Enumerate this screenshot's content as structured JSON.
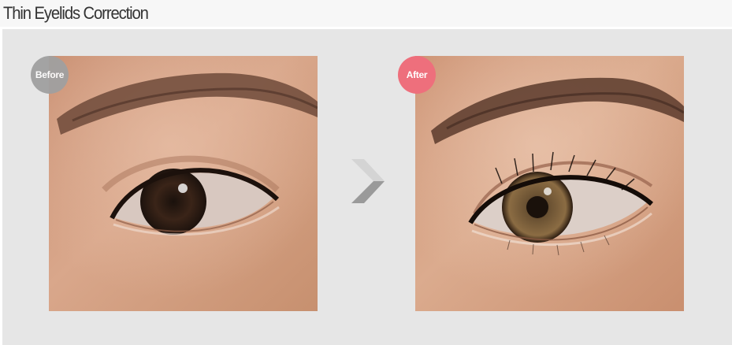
{
  "page": {
    "title": "Thin Eyelids Correction"
  },
  "comparison": {
    "before_label": "Before",
    "after_label": "After",
    "arrow_icon": "chevron-right-icon"
  },
  "colors": {
    "before_badge": "#a0a0a0",
    "after_badge": "#ee6f7c",
    "panel_background": "#e6e6e6"
  }
}
